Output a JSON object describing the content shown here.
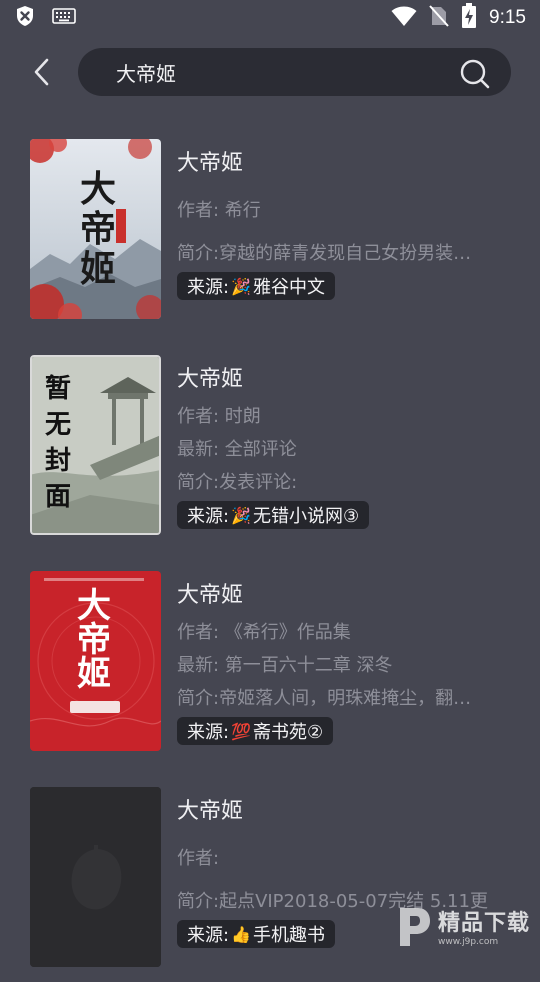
{
  "status_bar": {
    "time": "9:15",
    "icons": [
      "shield-x-icon",
      "keyboard-icon",
      "wifi-icon",
      "no-sim-icon",
      "battery-charging-icon"
    ]
  },
  "search": {
    "query": "大帝姬",
    "back_icon": "chevron-left-icon",
    "search_icon": "search-icon"
  },
  "books": [
    {
      "title": "大帝姬",
      "cover_text": "大帝姬",
      "author": "作者: 希行",
      "latest": "",
      "intro": "简介:穿越的薛青发现自己女扮男装…",
      "source_label": "来源:",
      "source_emoji": "🎉",
      "source_name": " 雅谷中文"
    },
    {
      "title": "大帝姬",
      "cover_text": "暂无封面",
      "author": "作者: 时朗",
      "latest": "最新: 全部评论",
      "intro": "简介:发表评论:",
      "source_label": "来源:",
      "source_emoji": "🎉",
      "source_name": "无错小说网③"
    },
    {
      "title": "大帝姬",
      "cover_text": "大帝姬",
      "author": "作者: 《希行》作品集",
      "latest": "最新: 第一百六十二章 深冬",
      "intro": "简介:帝姬落人间，明珠难掩尘，翻…",
      "source_label": "来源:",
      "source_emoji": "💯",
      "source_name": "斋书苑②"
    },
    {
      "title": "大帝姬",
      "cover_text": "",
      "author": "作者:",
      "latest": "",
      "intro": "简介:起点VIP2018-05-07完结 5.11更",
      "source_label": "来源:",
      "source_emoji": "👍",
      "source_name": " 手机趣书"
    }
  ],
  "watermark": {
    "text": "精品下载",
    "url": "www.j9p.com"
  },
  "colors": {
    "background": "#454651",
    "search_bg": "#2b2c34",
    "source_bg": "#25262c",
    "cover1": "#cfd6de",
    "cover3": "#c8232a"
  }
}
